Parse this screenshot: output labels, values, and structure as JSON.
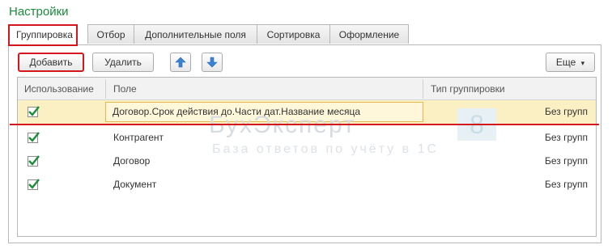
{
  "window": {
    "title": "Настройки"
  },
  "tabs": [
    {
      "label": "Группировка",
      "active": true
    },
    {
      "label": "Отбор",
      "active": false
    },
    {
      "label": "Дополнительные поля",
      "active": false
    },
    {
      "label": "Сортировка",
      "active": false
    },
    {
      "label": "Оформление",
      "active": false
    }
  ],
  "toolbar": {
    "add_label": "Добавить",
    "delete_label": "Удалить",
    "move_up_icon": "arrow-up-icon",
    "move_down_icon": "arrow-down-icon",
    "more_label": "Еще"
  },
  "grid": {
    "columns": [
      "Использование",
      "Поле",
      "Тип группировки"
    ],
    "rows": [
      {
        "use": true,
        "field": "Договор.Срок действия до.Части дат.Название месяца",
        "type": "Без групп",
        "selected": true
      },
      {
        "use": true,
        "field": "Контрагент",
        "type": "Без групп",
        "selected": false
      },
      {
        "use": true,
        "field": "Договор",
        "type": "Без групп",
        "selected": false
      },
      {
        "use": true,
        "field": "Документ",
        "type": "Без групп",
        "selected": false
      }
    ]
  },
  "watermark": {
    "text": "БухЭксперт",
    "badge": "8",
    "subtitle": "База ответов по учёту в 1С"
  },
  "colors": {
    "title": "#1a8c3a",
    "highlight": "#d4161d",
    "selected_row": "#fbf0c4",
    "checkmark": "#1a8c3a"
  }
}
